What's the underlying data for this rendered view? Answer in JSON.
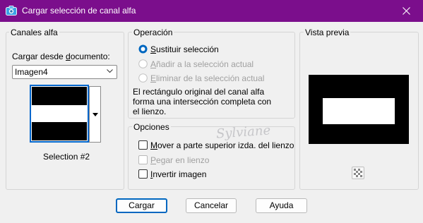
{
  "window": {
    "title": "Cargar selección de canal alfa",
    "close_label": "×"
  },
  "channels_group": {
    "legend": "Canales alfa",
    "load_from_label_pre": "Cargar desde ",
    "load_from_label_u": "d",
    "load_from_label_post": "ocumento:",
    "document_select_value": "Imagen4",
    "selection_name": "Selection #2"
  },
  "operation_group": {
    "legend": "Operación",
    "options": [
      {
        "u": "S",
        "rest": "ustituir selección",
        "checked": true,
        "enabled": true
      },
      {
        "u": "A",
        "rest": "ñadir a la selección actual",
        "checked": false,
        "enabled": false
      },
      {
        "u": "E",
        "rest": "liminar de la selección actual",
        "checked": false,
        "enabled": false
      }
    ],
    "description_lines": [
      "El rectángulo original del canal alfa",
      "forma una intersección completa con",
      "el lienzo."
    ]
  },
  "options_group": {
    "legend": "Opciones",
    "checkboxes": [
      {
        "u": "M",
        "rest": "over a parte superior izda. del lienzo",
        "checked": false,
        "enabled": true
      },
      {
        "u": "P",
        "rest": "egar en lienzo",
        "checked": false,
        "enabled": false
      },
      {
        "u": "I",
        "rest": "nvertir imagen",
        "checked": false,
        "enabled": true
      }
    ]
  },
  "preview_group": {
    "legend": "Vista previa"
  },
  "buttons": {
    "load": "Cargar",
    "cancel": "Cancelar",
    "help": "Ayuda"
  },
  "watermark": "Sylviane",
  "colors": {
    "titlebar": "#7b0e8c",
    "accent": "#0067c0",
    "background": "#f0f0f0"
  },
  "icons": {
    "app": "camera-icon",
    "close": "close-icon",
    "dropdown": "chevron-down-icon",
    "preview_toggle": "checkerboard-icon"
  }
}
